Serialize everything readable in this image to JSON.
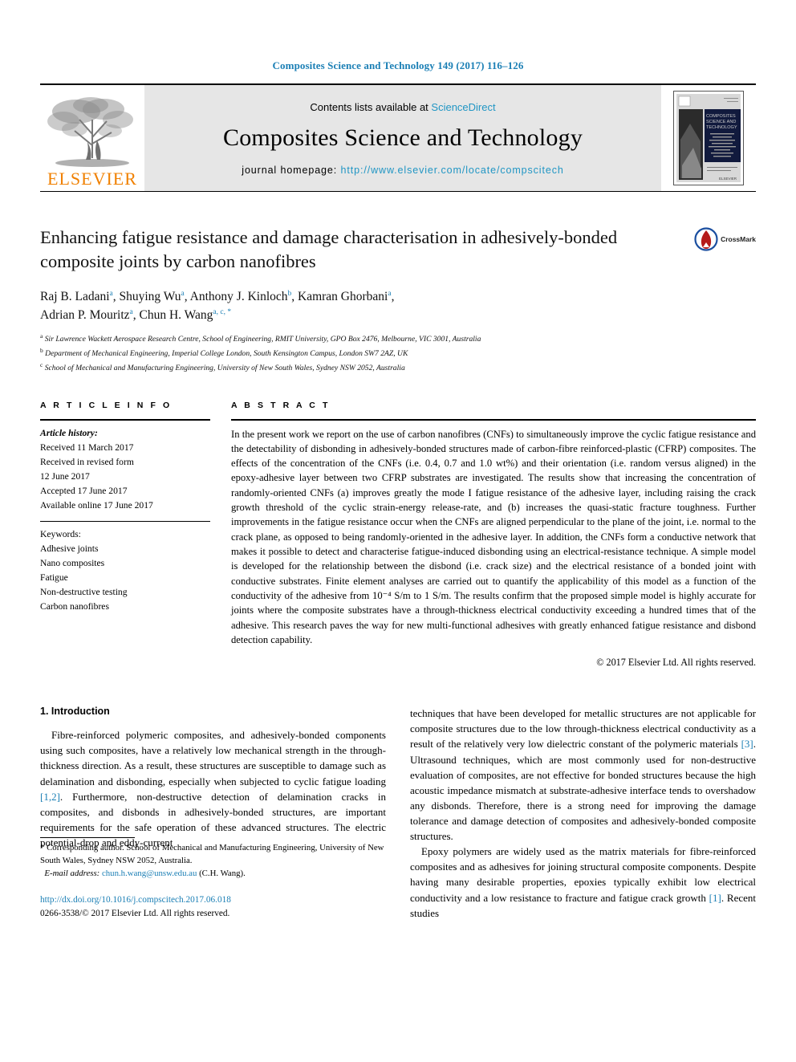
{
  "running_head": "Composites Science and Technology 149 (2017) 116–126",
  "masthead": {
    "publisher_name": "ELSEVIER",
    "contents_prefix": "Contents lists available at ",
    "sciencedirect": "ScienceDirect",
    "journal_title": "Composites Science and Technology",
    "homepage_label": "journal homepage: ",
    "homepage_url": "http://www.elsevier.com/locate/compscitech",
    "cover_title_lines": [
      "COMPOSITES",
      "SCIENCE AND",
      "TECHNOLOGY"
    ],
    "cover_publisher": "ELSEVIER"
  },
  "article": {
    "title": "Enhancing fatigue resistance and damage characterisation in adhesively-bonded composite joints by carbon nanofibres",
    "crossmark_label": "CrossMark",
    "authors": [
      {
        "name": "Raj B. Ladani",
        "marks": "a"
      },
      {
        "name": "Shuying Wu",
        "marks": "a"
      },
      {
        "name": "Anthony J. Kinloch",
        "marks": "b"
      },
      {
        "name": "Kamran Ghorbani",
        "marks": "a"
      },
      {
        "name": "Adrian P. Mouritz",
        "marks": "a"
      },
      {
        "name": "Chun H. Wang",
        "marks": "a, c, *"
      }
    ],
    "affiliations": [
      {
        "mark": "a",
        "text": "Sir Lawrence Wackett Aerospace Research Centre, School of Engineering, RMIT University, GPO Box 2476, Melbourne, VIC 3001, Australia"
      },
      {
        "mark": "b",
        "text": "Department of Mechanical Engineering, Imperial College London, South Kensington Campus, London SW7 2AZ, UK"
      },
      {
        "mark": "c",
        "text": "School of Mechanical and Manufacturing Engineering, University of New South Wales, Sydney NSW 2052, Australia"
      }
    ]
  },
  "article_info": {
    "heading": "A R T I C L E  I N F O",
    "history_label": "Article history:",
    "history": [
      "Received 11 March 2017",
      "Received in revised form",
      "12 June 2017",
      "Accepted 17 June 2017",
      "Available online 17 June 2017"
    ],
    "keywords_label": "Keywords:",
    "keywords": [
      "Adhesive joints",
      "Nano composites",
      "Fatigue",
      "Non-destructive testing",
      "Carbon nanofibres"
    ]
  },
  "abstract": {
    "heading": "A B S T R A C T",
    "text": "In the present work we report on the use of carbon nanofibres (CNFs) to simultaneously improve the cyclic fatigue resistance and the detectability of disbonding in adhesively-bonded structures made of carbon-fibre reinforced-plastic (CFRP) composites. The effects of the concentration of the CNFs (i.e. 0.4, 0.7 and 1.0 wt%) and their orientation (i.e. random versus aligned) in the epoxy-adhesive layer between two CFRP substrates are investigated. The results show that increasing the concentration of randomly-oriented CNFs (a) improves greatly the mode I fatigue resistance of the adhesive layer, including raising the crack growth threshold of the cyclic strain-energy release-rate, and (b) increases the quasi-static fracture toughness. Further improvements in the fatigue resistance occur when the CNFs are aligned perpendicular to the plane of the joint, i.e. normal to the crack plane, as opposed to being randomly-oriented in the adhesive layer. In addition, the CNFs form a conductive network that makes it possible to detect and characterise fatigue-induced disbonding using an electrical-resistance technique. A simple model is developed for the relationship between the disbond (i.e. crack size) and the electrical resistance of a bonded joint with conductive substrates. Finite element analyses are carried out to quantify the applicability of this model as a function of the conductivity of the adhesive from 10⁻⁴ S/m to 1 S/m. The results confirm that the proposed simple model is highly accurate for joints where the composite substrates have a through-thickness electrical conductivity exceeding a hundred times that of the adhesive. This research paves the way for new multi-functional adhesives with greatly enhanced fatigue resistance and disbond detection capability.",
    "copyright": "© 2017 Elsevier Ltd. All rights reserved."
  },
  "introduction": {
    "section_number": "1.",
    "section_title": "Introduction",
    "left_paragraph_1_part1": "Fibre-reinforced polymeric composites, and adhesively-bonded components using such composites, have a relatively low mechanical strength in the through-thickness direction. As a result, these structures are susceptible to damage such as delamination and disbonding, especially when subjected to cyclic fatigue loading ",
    "left_ref_1": "[1,2]",
    "left_paragraph_1_part2": ". Furthermore, non-destructive detection of delamination cracks in composites, and disbonds in adhesively-bonded structures, are important requirements for the safe operation of these advanced structures. The electric potential-drop and eddy-current",
    "right_paragraph_1_part1": "techniques that have been developed for metallic structures are not applicable for composite structures due to the low through-thickness electrical conductivity as a result of the relatively very low dielectric constant of the polymeric materials ",
    "right_ref_3": "[3]",
    "right_paragraph_1_part2": ". Ultrasound techniques, which are most commonly used for non-destructive evaluation of composites, are not effective for bonded structures because the high acoustic impedance mismatch at substrate-adhesive interface tends to overshadow any disbonds. Therefore, there is a strong need for improving the damage tolerance and damage detection of composites and adhesively-bonded composite structures.",
    "right_paragraph_2_part1": "Epoxy polymers are widely used as the matrix materials for fibre-reinforced composites and as adhesives for joining structural composite components. Despite having many desirable properties, epoxies typically exhibit low electrical conductivity and a low resistance to fracture and fatigue crack growth ",
    "right_ref_1": "[1]",
    "right_paragraph_2_part2": ". Recent studies"
  },
  "footer": {
    "corresponding_mark": "*",
    "corresponding_text": " Corresponding author. School of Mechanical and Manufacturing Engineering, University of New South Wales, Sydney NSW 2052, Australia.",
    "email_label": "E-mail address:",
    "email": "chun.h.wang@unsw.edu.au",
    "email_owner": "(C.H. Wang).",
    "doi": "http://dx.doi.org/10.1016/j.compscitech.2017.06.018",
    "issn_copyright": "0266-3538/© 2017 Elsevier Ltd. All rights reserved."
  },
  "colors": {
    "link_blue": "#1b7fb5",
    "sciencedirect_blue": "#2196c4",
    "elsevier_orange": "#f08000",
    "masthead_gray": "#e6e6e6"
  }
}
